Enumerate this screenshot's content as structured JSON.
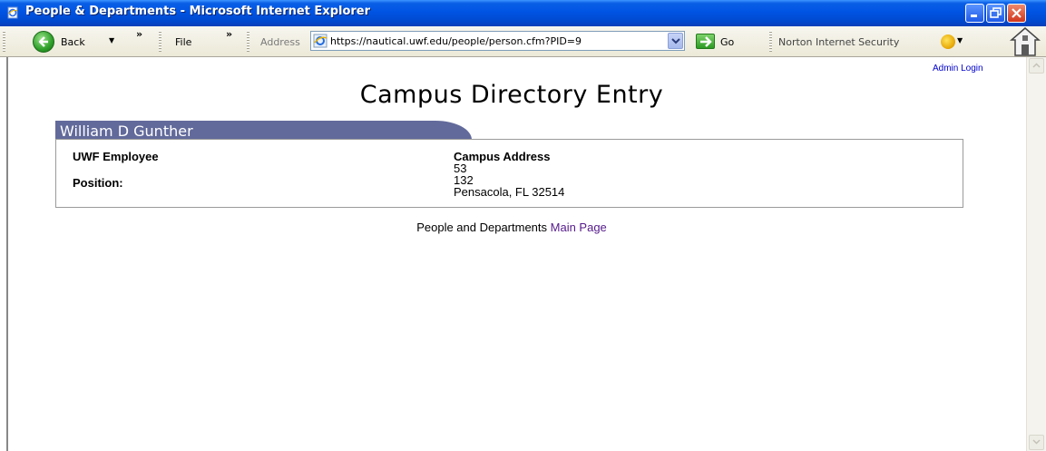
{
  "window": {
    "title": "People & Departments - Microsoft Internet Explorer"
  },
  "toolbar": {
    "back_label": "Back",
    "back_dropdown": "▼",
    "chevron_1": "»",
    "file_label": "File",
    "chevron_2": "»",
    "address_label": "Address",
    "address_url": "https://nautical.uwf.edu/people/person.cfm?PID=9",
    "go_label": "Go",
    "norton_label": "Norton Internet Security",
    "norton_dropdown": "▼"
  },
  "page": {
    "admin_login": "Admin Login",
    "title": "Campus Directory Entry",
    "person_name": "William D Gunther",
    "employee_type": "UWF Employee",
    "position_label": "Position:",
    "campus_address_label": "Campus Address",
    "address_line_1": "53",
    "address_line_2": "132",
    "address_line_3": "Pensacola, FL 32514",
    "footer_text": "People and Departments ",
    "footer_link": "Main Page"
  },
  "colors": {
    "title_bar": "#0054e3",
    "name_tab": "#626a9b",
    "link": "#0000cc",
    "visited_link": "#551a8b"
  },
  "icons": {
    "title": "ie-page-icon",
    "back": "back-arrow-icon",
    "address": "ie-logo-icon",
    "go": "go-arrow-icon",
    "norton": "norton-icon",
    "home": "home-icon"
  }
}
